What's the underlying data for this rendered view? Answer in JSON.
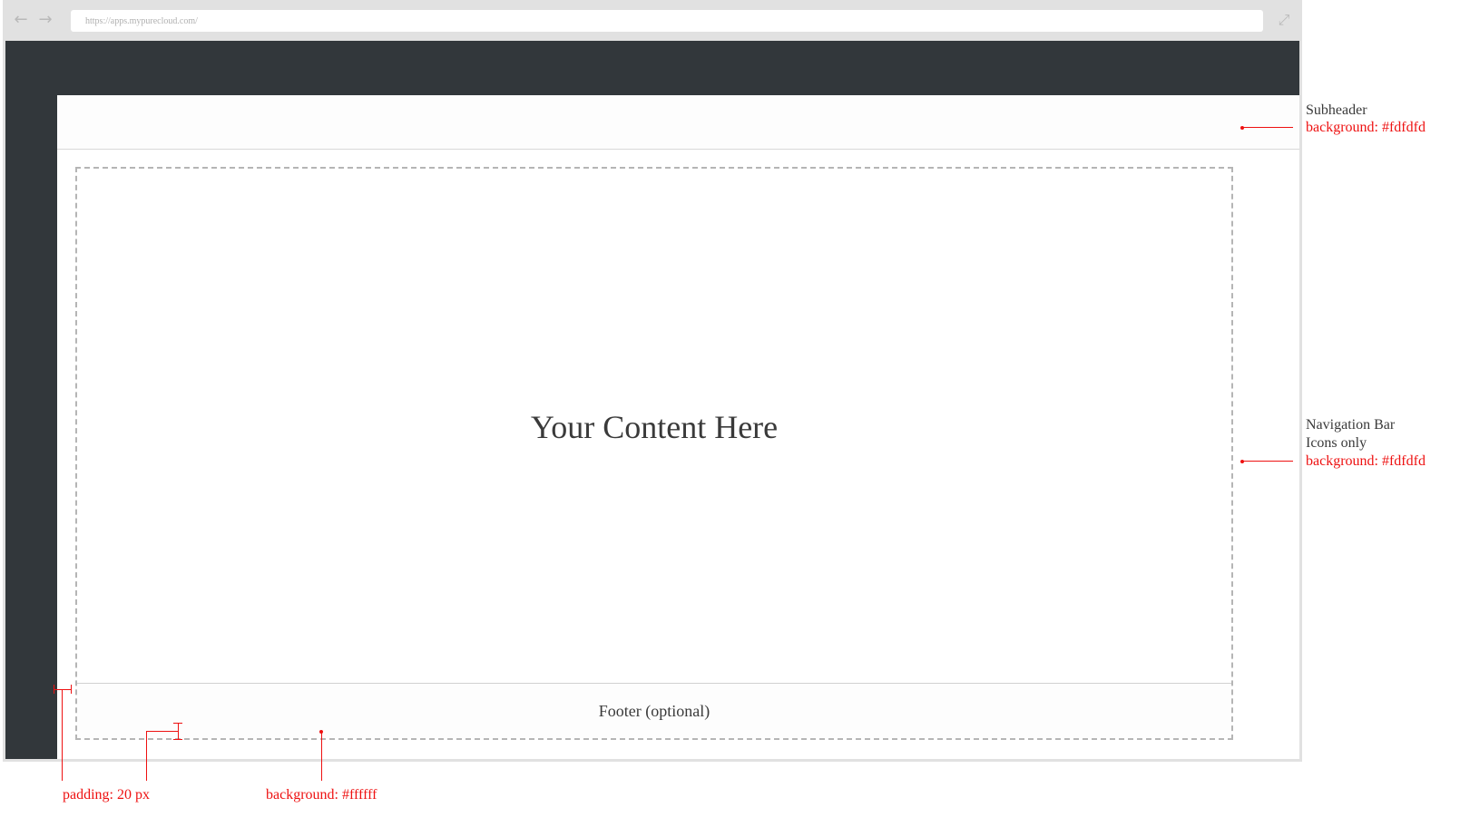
{
  "browser": {
    "url": "https://apps.mypurecloud.com/",
    "back_icon": "arrow-left-icon",
    "forward_icon": "arrow-right-icon",
    "expand_icon": "expand-icon"
  },
  "content": {
    "placeholder": "Your Content Here",
    "footer": "Footer  (optional)"
  },
  "annotations": {
    "subheader": {
      "title": "Subheader",
      "background": "background: #fdfdfd"
    },
    "navigation_bar": {
      "title": "Navigation Bar",
      "subtitle": "Icons only",
      "background": "background: #fdfdfd"
    },
    "padding": "padding: 20 px",
    "content_background": "background: #ffffff"
  },
  "colors": {
    "nav_bar": "#32373b",
    "subheader": "#fdfdfd",
    "content": "#ffffff",
    "annotation": "#ee1111"
  }
}
